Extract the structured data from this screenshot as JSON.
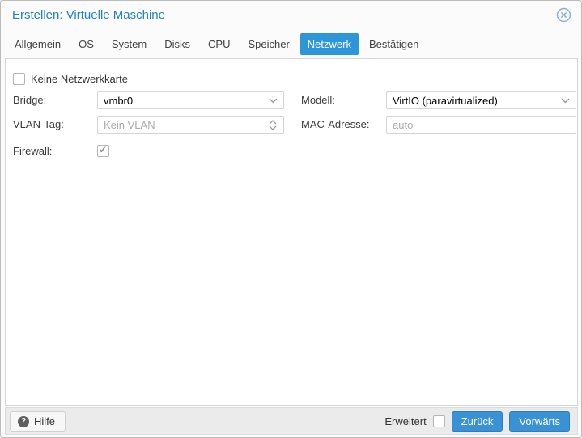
{
  "window": {
    "title": "Erstellen: Virtuelle Maschine",
    "close_icon": "circle-x-icon"
  },
  "colors": {
    "title_blue": "#2280c6",
    "tab_active_bg": "#2d96d8",
    "button_blue": "#3a92d6",
    "toolbar_bg": "#ebebeb",
    "panel_border": "#d6d6d6",
    "placeholder_gray": "#ababab",
    "check_gray": "#8f8f8f"
  },
  "tabs": {
    "items": [
      {
        "label": "Allgemein",
        "active": false
      },
      {
        "label": "OS",
        "active": false
      },
      {
        "label": "System",
        "active": false
      },
      {
        "label": "Disks",
        "active": false
      },
      {
        "label": "CPU",
        "active": false
      },
      {
        "label": "Speicher",
        "active": false
      },
      {
        "label": "Netzwerk",
        "active": true
      },
      {
        "label": "Bestätigen",
        "active": false
      }
    ]
  },
  "form": {
    "no_nic": {
      "label": "Keine Netzwerkkarte",
      "checked": false
    },
    "bridge": {
      "label": "Bridge:",
      "value": "vmbr0"
    },
    "vlan": {
      "label": "VLAN-Tag:",
      "placeholder": "Kein VLAN"
    },
    "firewall": {
      "label": "Firewall:",
      "checked": true
    },
    "model": {
      "label": "Modell:",
      "value": "VirtIO (paravirtualized)"
    },
    "mac": {
      "label": "MAC-Adresse:",
      "placeholder": "auto"
    }
  },
  "footer": {
    "help_label": "Hilfe",
    "help_icon_glyph": "?",
    "advanced_label": "Erweitert",
    "advanced_checked": false,
    "back_label": "Zurück",
    "next_label": "Vorwärts"
  }
}
